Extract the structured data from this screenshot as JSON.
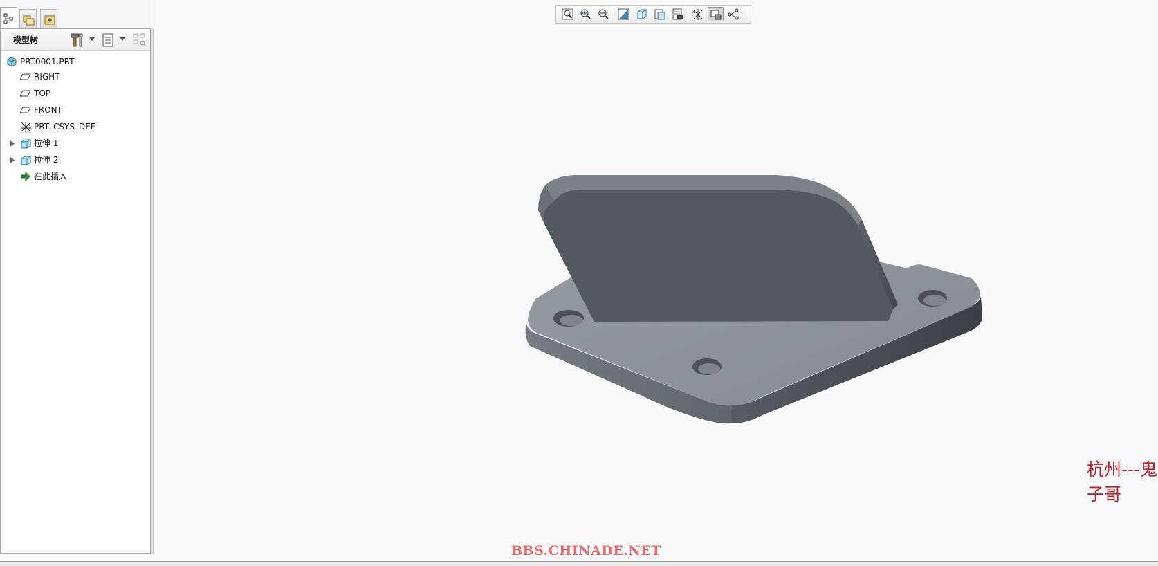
{
  "panel_tabs": [
    {
      "name": "model-tree-tab",
      "icon": "tree-structure-icon",
      "active": true
    },
    {
      "name": "folder-browser-tab",
      "icon": "folder-browser-icon",
      "active": false
    },
    {
      "name": "favorites-tab",
      "icon": "favorites-icon",
      "active": false
    }
  ],
  "tree": {
    "title": "模型树",
    "toolbar_icons": [
      "settings-tools-icon",
      "show-icon",
      "filter-icon"
    ],
    "items": [
      {
        "label": "PRT0001.PRT",
        "icon": "part-icon",
        "expandable": false
      },
      {
        "label": "RIGHT",
        "icon": "datum-plane-icon",
        "expandable": false
      },
      {
        "label": "TOP",
        "icon": "datum-plane-icon",
        "expandable": false
      },
      {
        "label": "FRONT",
        "icon": "datum-plane-icon",
        "expandable": false
      },
      {
        "label": "PRT_CSYS_DEF",
        "icon": "coordinate-system-icon",
        "expandable": false
      },
      {
        "label": "拉伸 1",
        "icon": "extrude-icon",
        "expandable": true
      },
      {
        "label": "拉伸 2",
        "icon": "extrude-icon",
        "expandable": true
      },
      {
        "label": "在此插入",
        "icon": "insert-here-arrow-icon",
        "expandable": false
      }
    ]
  },
  "graphics_toolbar": [
    {
      "name": "refit-button",
      "icon": "refit-icon"
    },
    {
      "name": "zoom-in-button",
      "icon": "zoom-in-icon"
    },
    {
      "name": "zoom-out-button",
      "icon": "zoom-out-icon"
    },
    {
      "name": "repaint-button",
      "icon": "repaint-icon"
    },
    {
      "name": "display-style-button",
      "icon": "display-style-icon"
    },
    {
      "name": "saved-orientations-button",
      "icon": "saved-views-icon"
    },
    {
      "name": "view-manager-button",
      "icon": "view-manager-icon"
    },
    {
      "name": "datum-display-button",
      "icon": "datum-display-icon"
    },
    {
      "name": "spin-center-button",
      "icon": "spin-center-icon",
      "pressed": true
    },
    {
      "name": "annotation-display-button",
      "icon": "annotation-display-icon"
    }
  ],
  "watermarks": {
    "author": "杭州---鬼子哥",
    "site": "BBS.CHINADE.NET"
  },
  "colors": {
    "model_light": "#8e939c",
    "model_dark": "#565b63",
    "model_shadow": "#3f444b",
    "author_watermark": "#c0232a",
    "site_watermark": "#ec6a6a"
  }
}
